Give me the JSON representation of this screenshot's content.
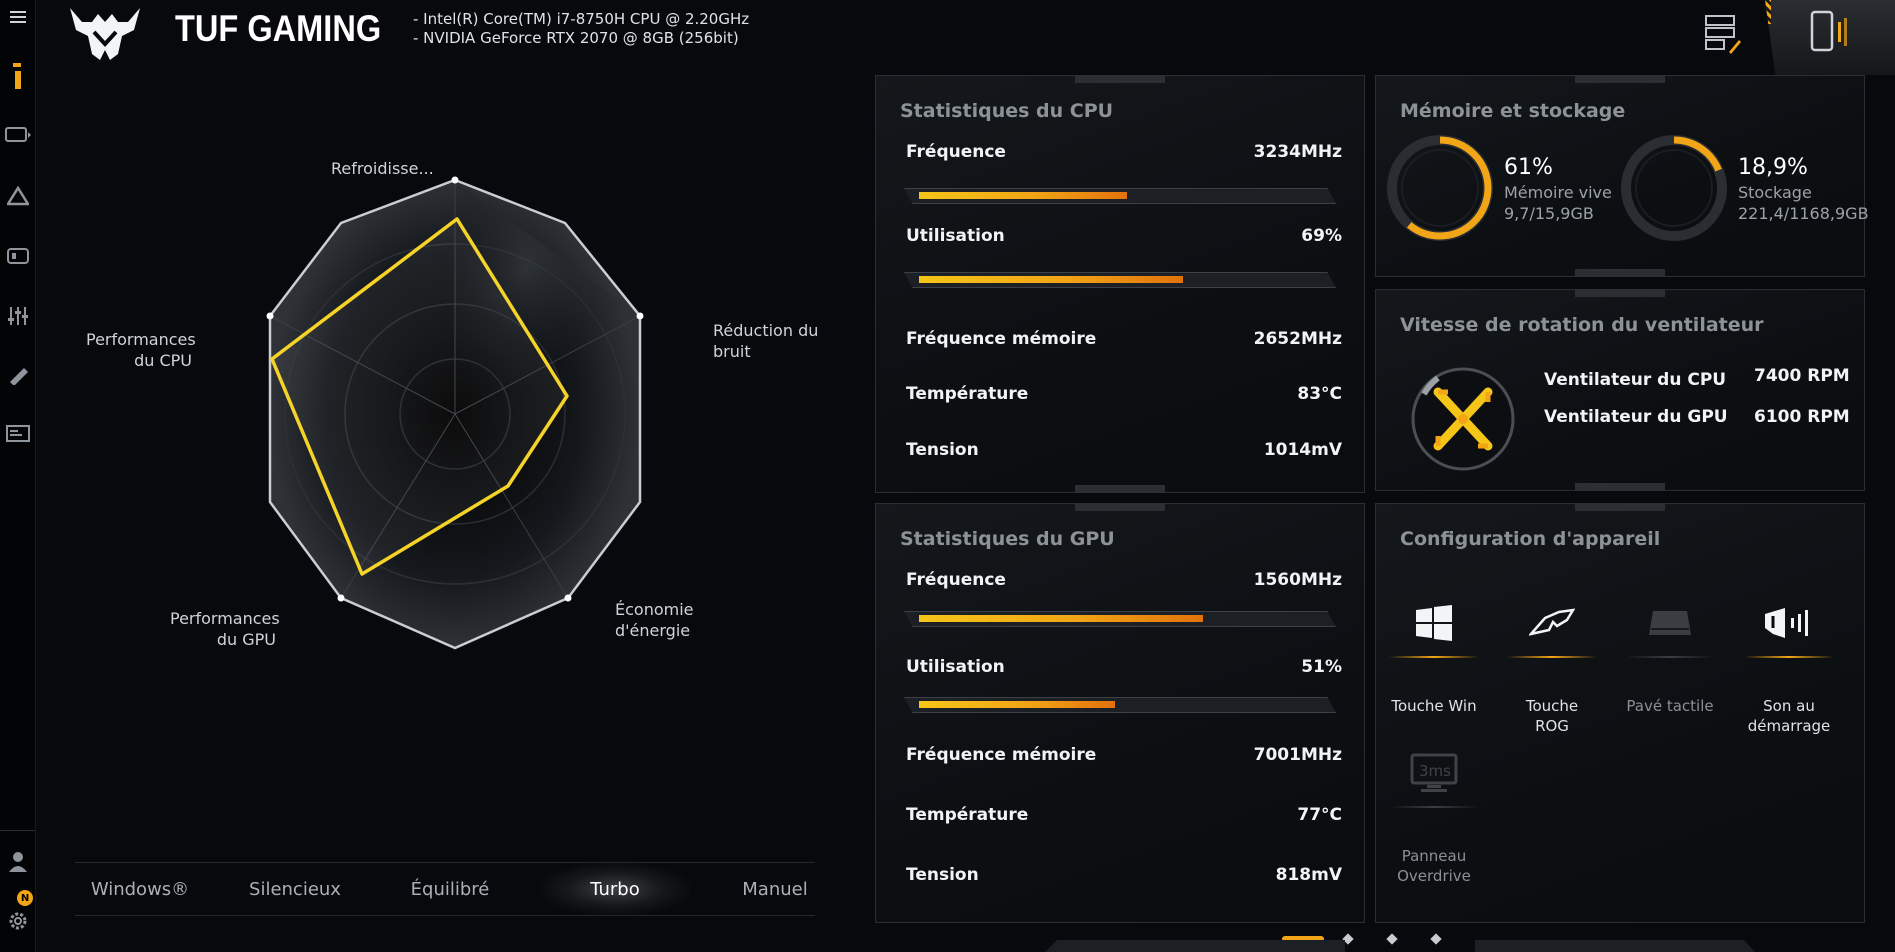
{
  "header": {
    "brand": "TUF GAMING",
    "cpu_info": "-  Intel(R) Core(TM) i7-8750H CPU @ 2.20GHz",
    "gpu_info": "-  NVIDIA GeForce RTX 2070 @ 8GB (256bit)"
  },
  "radar": {
    "labels": {
      "cooling": "Refroidisse...",
      "noise": [
        "Réduction du",
        "bruit"
      ],
      "energy": [
        "Économie",
        "d'énergie"
      ],
      "gpu": [
        "Performances",
        "du GPU"
      ],
      "cpu": [
        "Performances",
        "du CPU"
      ]
    }
  },
  "modes": [
    "Windows®",
    "Silencieux",
    "Équilibré",
    "Turbo",
    "Manuel"
  ],
  "active_mode": "Turbo",
  "cpu_stats": {
    "title": "Statistiques du CPU",
    "frequency_label": "Fréquence",
    "frequency_value": "3234MHz",
    "frequency_bar": 0.52,
    "usage_label": "Utilisation",
    "usage_value": "69%",
    "usage_bar": 0.66,
    "mem_freq_label": "Fréquence mémoire",
    "mem_freq_value": "2652MHz",
    "temp_label": "Température",
    "temp_value": "83°C",
    "voltage_label": "Tension",
    "voltage_value": "1014mV"
  },
  "gpu_stats": {
    "title": "Statistiques du GPU",
    "frequency_label": "Fréquence",
    "frequency_value": "1560MHz",
    "frequency_bar": 0.71,
    "usage_label": "Utilisation",
    "usage_value": "51%",
    "usage_bar": 0.49,
    "mem_freq_label": "Fréquence mémoire",
    "mem_freq_value": "7001MHz",
    "temp_label": "Température",
    "temp_value": "77°C",
    "voltage_label": "Tension",
    "voltage_value": "818mV"
  },
  "memory": {
    "title": "Mémoire et stockage",
    "ram_pct": "61%",
    "ram_label": "Mémoire vive",
    "ram_detail": "9,7/15,9GB",
    "ram_fraction": 0.61,
    "storage_pct": "18,9%",
    "storage_label": "Stockage",
    "storage_detail": "221,4/1168,9GB",
    "storage_fraction": 0.189
  },
  "fan": {
    "title": "Vitesse de rotation du ventilateur",
    "cpu_label": "Ventilateur du CPU",
    "cpu_value": "7400 RPM",
    "gpu_label": "Ventilateur du GPU",
    "gpu_value": "6100 RPM"
  },
  "device": {
    "title": "Configuration d'appareil",
    "items": [
      {
        "label": "Touche Win",
        "icon": "windows-icon",
        "enabled": true
      },
      {
        "label": "Touche ROG",
        "icon": "rog-icon",
        "enabled": true
      },
      {
        "label": "Pavé tactile",
        "icon": "touchpad-icon",
        "enabled": false
      },
      {
        "label": "Son au démarrage",
        "icon": "boot-sound-icon",
        "enabled": true
      },
      {
        "label": "Panneau Overdrive",
        "icon": "overdrive-icon",
        "enabled": false
      }
    ]
  },
  "notification_count": "N",
  "colors": {
    "accent": "#f2a516",
    "accent_yellow": "#f5c518",
    "background": "#07090c"
  }
}
